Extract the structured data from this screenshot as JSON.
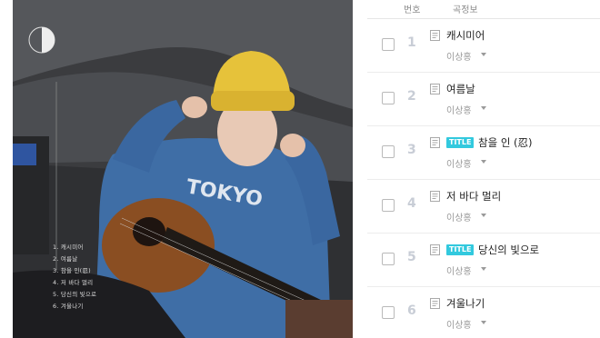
{
  "album": {
    "tracklist": [
      "1. 캐시미어",
      "2. 여름날",
      "3. 참을 인(忍)",
      "4. 저 바다 멀리",
      "5. 당신의 빛으로",
      "6. 겨울나기"
    ]
  },
  "header": {
    "number": "번호",
    "song_info": "곡정보"
  },
  "title_badge": "TITLE",
  "tracks": [
    {
      "number": "1",
      "title": "캐시미어",
      "artist": "이상홍",
      "is_title": false
    },
    {
      "number": "2",
      "title": "여름날",
      "artist": "이상홍",
      "is_title": false
    },
    {
      "number": "3",
      "title": "참을 인 (忍)",
      "artist": "이상홍",
      "is_title": true
    },
    {
      "number": "4",
      "title": "저 바다 멀리",
      "artist": "이상홍",
      "is_title": false
    },
    {
      "number": "5",
      "title": "당신의 빛으로",
      "artist": "이상홍",
      "is_title": true
    },
    {
      "number": "6",
      "title": "겨울나기",
      "artist": "이상홍",
      "is_title": false
    }
  ],
  "colors": {
    "badge": "#32c9de",
    "beanie": "#e6c23a",
    "hoodie": "#3f6ea6"
  }
}
